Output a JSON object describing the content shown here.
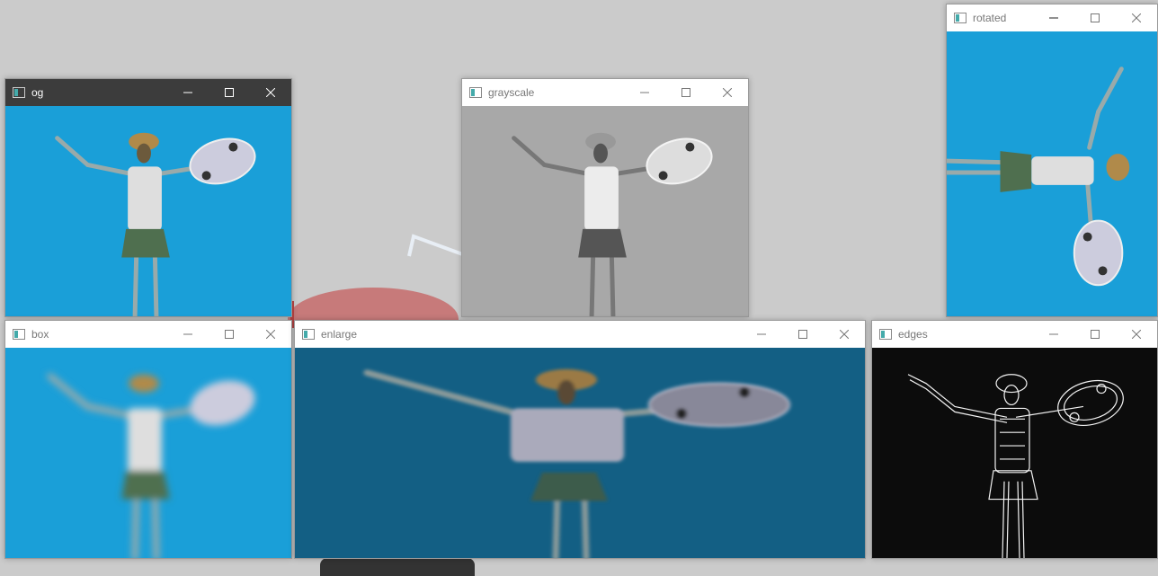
{
  "desktop": {
    "background": "#cbcbcb"
  },
  "windows": [
    {
      "id": "og",
      "title": "og",
      "active": true,
      "content": "original-photo"
    },
    {
      "id": "grayscale",
      "title": "grayscale",
      "active": false,
      "content": "grayscale-photo"
    },
    {
      "id": "rotated",
      "title": "rotated",
      "active": false,
      "content": "rotated-photo"
    },
    {
      "id": "box",
      "title": "box",
      "active": false,
      "content": "blurred-photo"
    },
    {
      "id": "enlarge",
      "title": "enlarge",
      "active": false,
      "content": "enlarged-photo"
    },
    {
      "id": "edges",
      "title": "edges",
      "active": false,
      "content": "edge-detected-photo"
    }
  ],
  "colors": {
    "sky": "#1a9fd8",
    "gray": "#a8a8a8",
    "dark_sky": "#135f84",
    "edges_bg": "#0c0c0c"
  }
}
